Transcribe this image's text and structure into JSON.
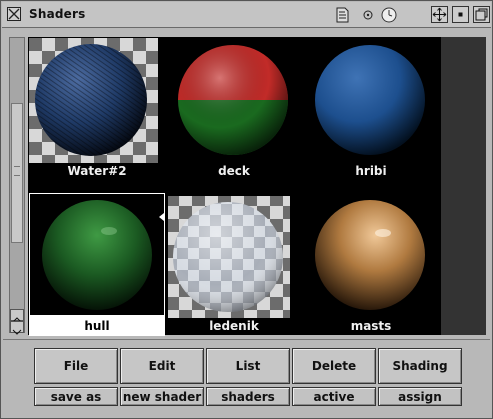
{
  "window": {
    "title": "Shaders"
  },
  "shaders": [
    {
      "name": "Water#2",
      "selected": false
    },
    {
      "name": "deck",
      "selected": false
    },
    {
      "name": "hribi",
      "selected": false
    },
    {
      "name": "hull",
      "selected": true
    },
    {
      "name": "ledenik",
      "selected": false
    },
    {
      "name": "masts",
      "selected": false
    }
  ],
  "menu_buttons": [
    "File",
    "Edit",
    "List",
    "Delete",
    "Shading"
  ],
  "sub_buttons": [
    "save as",
    "new shader",
    "shaders",
    "active",
    "assign"
  ],
  "colors": {
    "water": "#1f3a66",
    "deck_top": "#c22b28",
    "deck_bottom": "#1a6a1f",
    "hribi": "#1d4f8e",
    "hull": "#1b5a22",
    "ledenik": "#c4cad2",
    "masts": "#b07a40"
  },
  "icons": [
    "close-icon",
    "document-icon",
    "target-icon",
    "clock-icon",
    "move-icon",
    "minimize-icon",
    "restore-icon"
  ]
}
